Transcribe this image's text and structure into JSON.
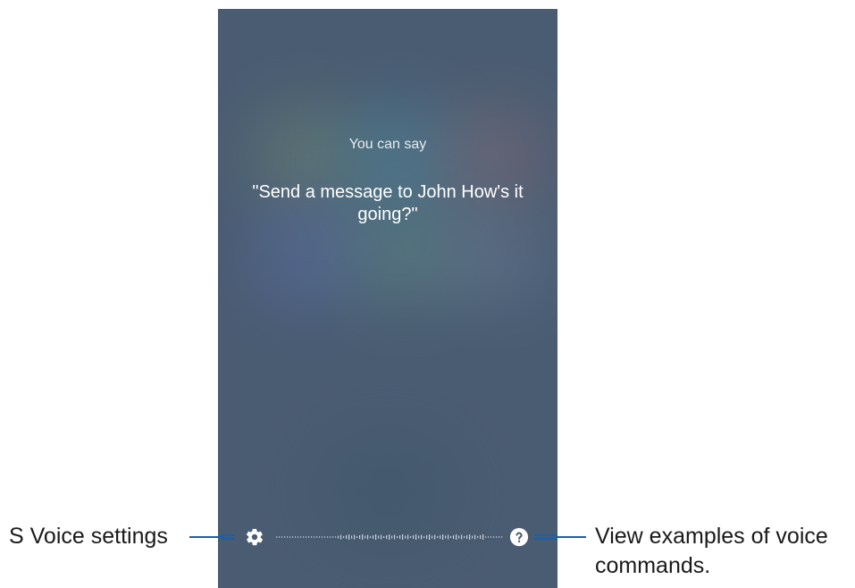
{
  "screen": {
    "hint_label": "You can say",
    "hint_quote": "\"Send a message to John How's it going?\""
  },
  "icons": {
    "settings": "gear-icon",
    "help": "question-circle-icon"
  },
  "callouts": {
    "left": "S Voice settings",
    "right_line1": "View examples of voice",
    "right_line2": "commands."
  },
  "colors": {
    "screen_bg": "#4a5c72",
    "callout_line": "#1a5fa8",
    "text_light": "#ffffff"
  }
}
